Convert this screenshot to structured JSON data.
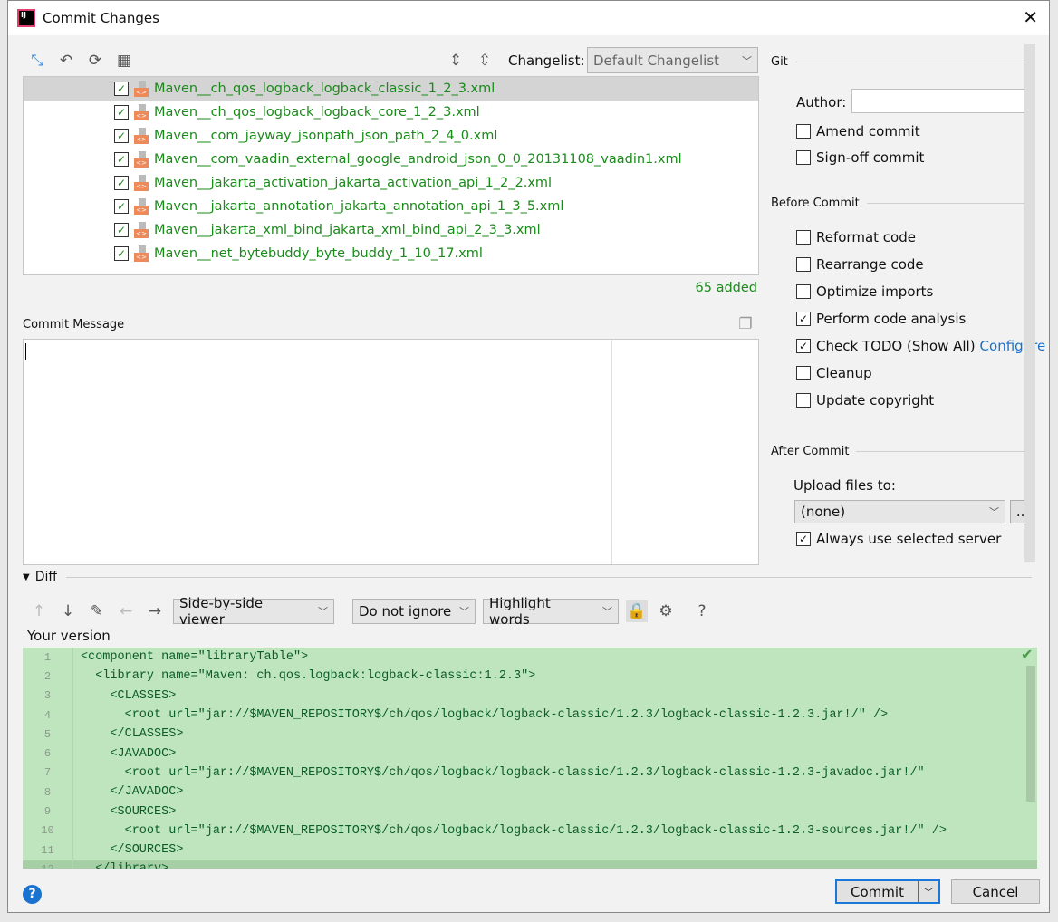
{
  "window": {
    "title": "Commit Changes",
    "close": "✕"
  },
  "toolbar": {
    "changelist_label": "Changelist:",
    "changelist_value": "Default Changelist"
  },
  "files": [
    "Maven__ch_qos_logback_logback_classic_1_2_3.xml",
    "Maven__ch_qos_logback_logback_core_1_2_3.xml",
    "Maven__com_jayway_jsonpath_json_path_2_4_0.xml",
    "Maven__com_vaadin_external_google_android_json_0_0_20131108_vaadin1.xml",
    "Maven__jakarta_activation_jakarta_activation_api_1_2_2.xml",
    "Maven__jakarta_annotation_jakarta_annotation_api_1_3_5.xml",
    "Maven__jakarta_xml_bind_jakarta_xml_bind_api_2_3_3.xml",
    "Maven__net_bytebuddy_byte_buddy_1_10_17.xml"
  ],
  "summary": "65 added",
  "commit_message": {
    "label": "Commit Message",
    "value": ""
  },
  "git": {
    "section": "Git",
    "author_label": "Author:",
    "author_value": "",
    "amend": "Amend commit",
    "signoff": "Sign-off commit"
  },
  "before_commit": {
    "section": "Before Commit",
    "options": [
      {
        "label": "Reformat code",
        "checked": false
      },
      {
        "label": "Rearrange code",
        "checked": false
      },
      {
        "label": "Optimize imports",
        "checked": false
      },
      {
        "label": "Perform code analysis",
        "checked": true
      },
      {
        "label": "Check TODO (Show All)",
        "checked": true
      },
      {
        "label": "Cleanup",
        "checked": false
      },
      {
        "label": "Update copyright",
        "checked": false
      }
    ],
    "configure_link": "Configure"
  },
  "after_commit": {
    "section": "After Commit",
    "upload_label": "Upload files to:",
    "upload_value": "(none)",
    "browse": "...",
    "always_use": "Always use selected server"
  },
  "diff": {
    "section": "Diff",
    "viewer": "Side-by-side viewer",
    "ignore": "Do not ignore",
    "highlight": "Highlight words",
    "help": "?",
    "your_version": "Your version",
    "lines": [
      "<component name=\"libraryTable\">",
      "  <library name=\"Maven: ch.qos.logback:logback-classic:1.2.3\">",
      "    <CLASSES>",
      "      <root url=\"jar://$MAVEN_REPOSITORY$/ch/qos/logback/logback-classic/1.2.3/logback-classic-1.2.3.jar!/\" />",
      "    </CLASSES>",
      "    <JAVADOC>",
      "      <root url=\"jar://$MAVEN_REPOSITORY$/ch/qos/logback/logback-classic/1.2.3/logback-classic-1.2.3-javadoc.jar!/\"",
      "    </JAVADOC>",
      "    <SOURCES>",
      "      <root url=\"jar://$MAVEN_REPOSITORY$/ch/qos/logback/logback-classic/1.2.3/logback-classic-1.2.3-sources.jar!/\" />",
      "    </SOURCES>",
      "  </library>"
    ]
  },
  "buttons": {
    "commit": "Commit",
    "cancel": "Cancel"
  },
  "colors": {
    "added_bg": "#bee5be",
    "file_added": "#1a8a1a",
    "link": "#1a73c9"
  }
}
